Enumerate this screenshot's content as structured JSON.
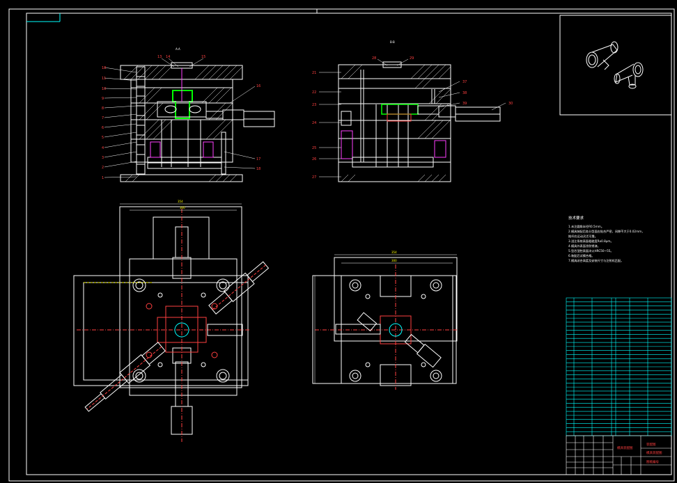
{
  "drawing": {
    "background": "#000000",
    "line_color": "#ffffff",
    "accent_colors": {
      "cyan": "#00ffff",
      "red": "#ff0000",
      "yellow": "#ffff00",
      "green": "#00ff00",
      "magenta": "#ff40ff"
    },
    "section_a_title": "A-A",
    "section_b_title": "B-B",
    "left_callouts": [
      "18",
      "11",
      "10",
      "9",
      "8",
      "7",
      "6",
      "5",
      "4",
      "3",
      "2",
      "1"
    ],
    "top_callouts_a": [
      "13",
      "14",
      "15"
    ],
    "right_callouts_a": [
      "16",
      "17",
      "18"
    ],
    "top_callouts_b": [
      "28",
      "29"
    ],
    "left_callouts_b": [
      "21",
      "22",
      "23",
      "24",
      "25",
      "26",
      "27"
    ],
    "right_callouts_b": [
      "37",
      "38",
      "39",
      "30"
    ],
    "tech_req_title": "技术要求",
    "tech_req_lines": [
      "1.未注圆角半径R0.5mm。",
      "2.模具装配后各分型面应贴合严密，间隙不大于0.02mm，",
      "   推杆应运动灵活可靠。",
      "3.浇注系统表面粗糙度Ra0.8μm。",
      "4.模具外表面涂防锈漆。",
      "5.型芯型腔表面淬火HRC50~55。",
      "6.装配后试模合格。",
      "7.模具闭合高度及安装尺寸与注射机匹配。"
    ],
    "bom_rows": 34,
    "title_block_name": "模具装配图",
    "title_block_school": "装配图",
    "title_block_drawing_no": "图纸编号"
  }
}
